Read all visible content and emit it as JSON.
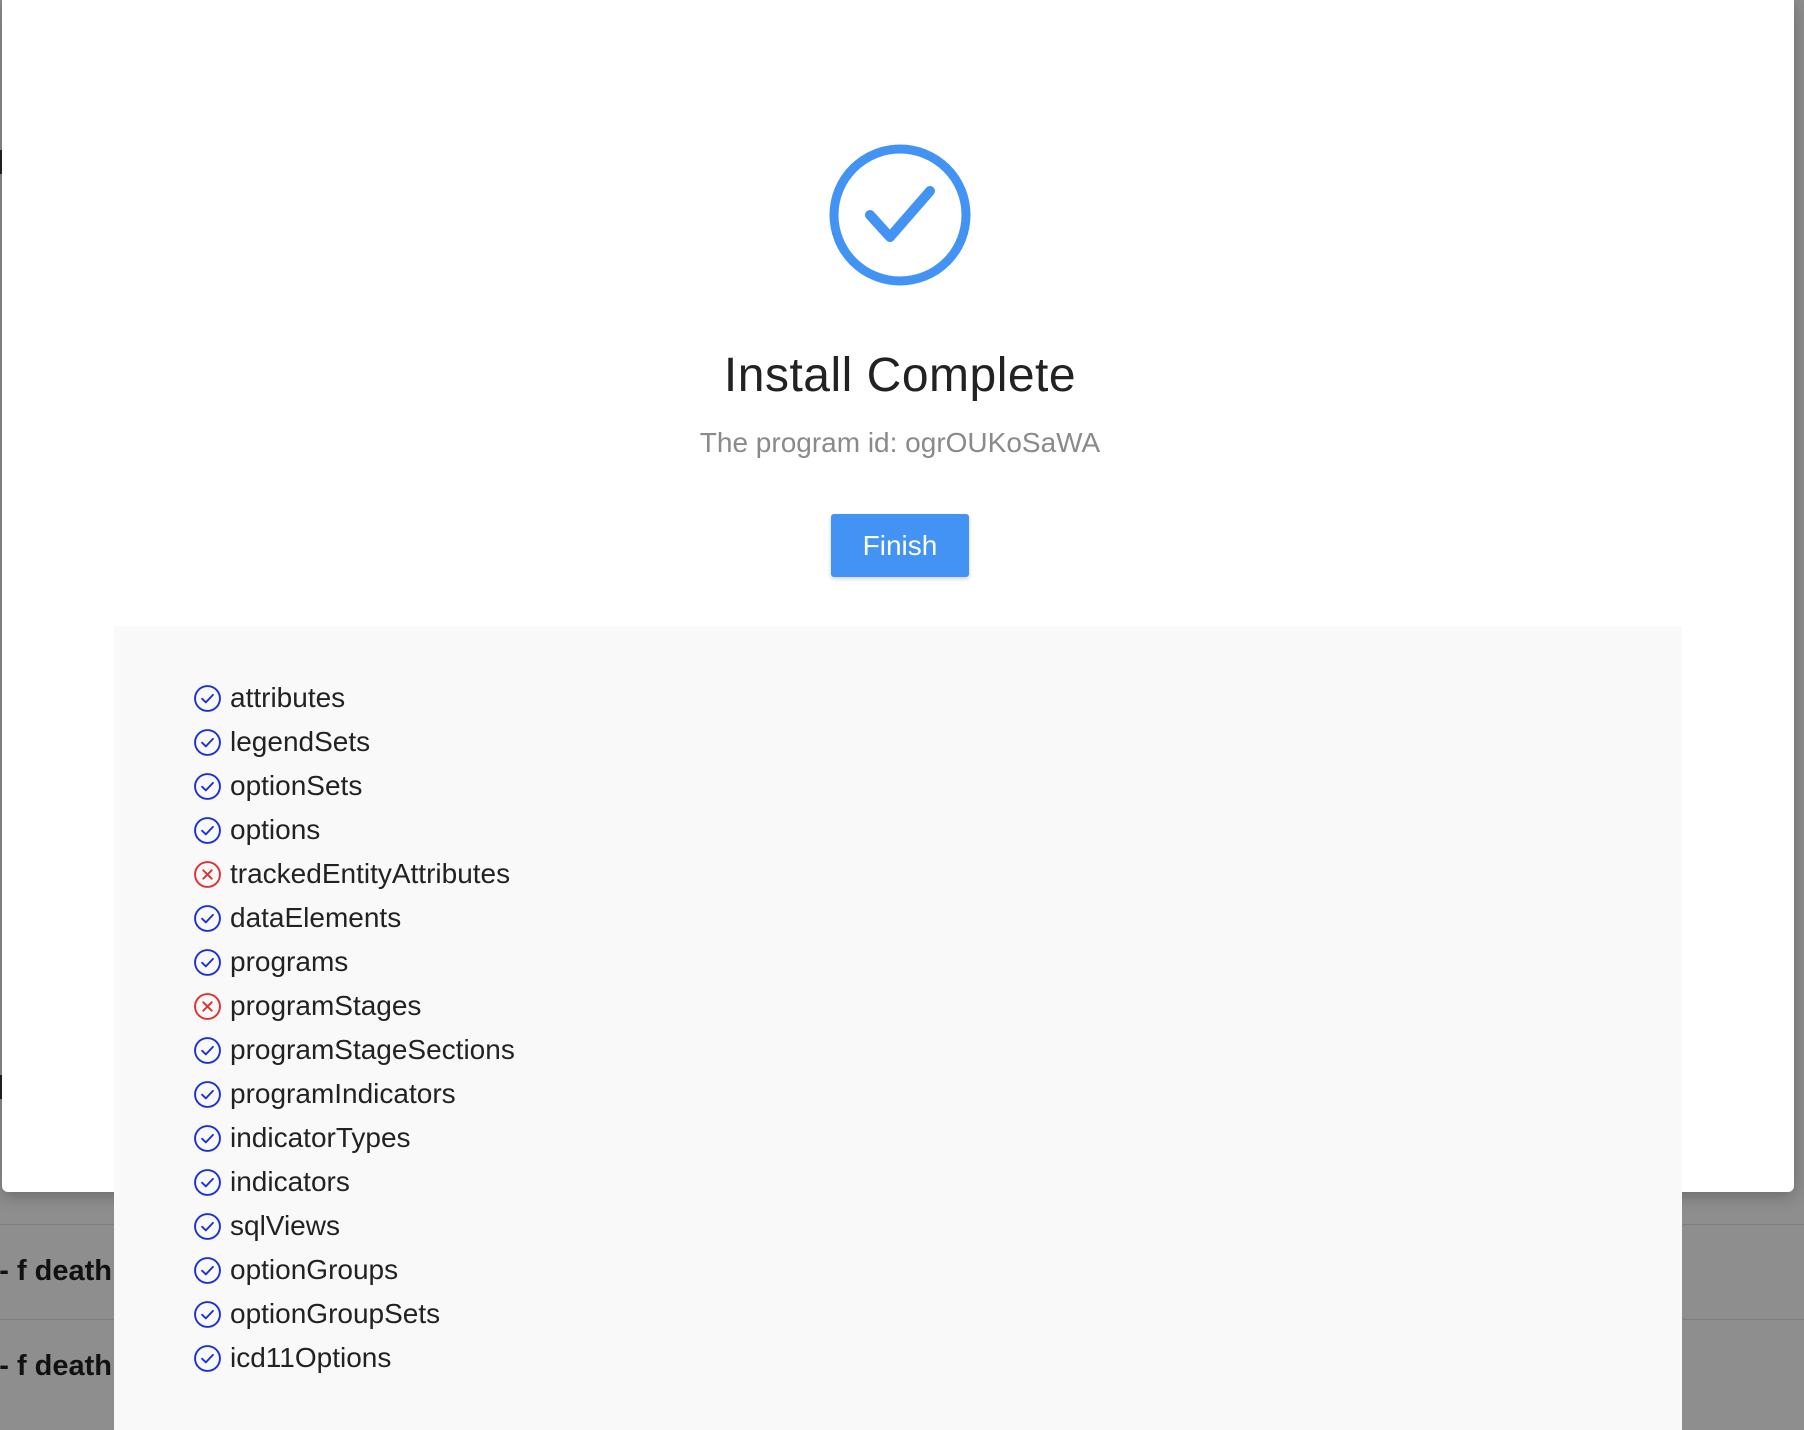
{
  "background": {
    "rows": [
      {
        "label": "f death -"
      },
      {
        "label": "f death -"
      }
    ]
  },
  "modal": {
    "title": "Install Complete",
    "subtitle": "The program id: ogrOUKoSaWA",
    "finish_label": "Finish",
    "colors": {
      "accent": "#4293f3",
      "success_icon": "#1a33d6",
      "error_icon": "#e03131"
    }
  },
  "results": [
    {
      "label": "attributes",
      "status": "success",
      "icon": "check-circle-icon"
    },
    {
      "label": "legendSets",
      "status": "success",
      "icon": "check-circle-icon"
    },
    {
      "label": "optionSets",
      "status": "success",
      "icon": "check-circle-icon"
    },
    {
      "label": "options",
      "status": "success",
      "icon": "check-circle-icon"
    },
    {
      "label": "trackedEntityAttributes",
      "status": "error",
      "icon": "x-circle-icon"
    },
    {
      "label": "dataElements",
      "status": "success",
      "icon": "check-circle-icon"
    },
    {
      "label": "programs",
      "status": "success",
      "icon": "check-circle-icon"
    },
    {
      "label": "programStages",
      "status": "error",
      "icon": "x-circle-icon"
    },
    {
      "label": "programStageSections",
      "status": "success",
      "icon": "check-circle-icon"
    },
    {
      "label": "programIndicators",
      "status": "success",
      "icon": "check-circle-icon"
    },
    {
      "label": "indicatorTypes",
      "status": "success",
      "icon": "check-circle-icon"
    },
    {
      "label": "indicators",
      "status": "success",
      "icon": "check-circle-icon"
    },
    {
      "label": "sqlViews",
      "status": "success",
      "icon": "check-circle-icon"
    },
    {
      "label": "optionGroups",
      "status": "success",
      "icon": "check-circle-icon"
    },
    {
      "label": "optionGroupSets",
      "status": "success",
      "icon": "check-circle-icon"
    },
    {
      "label": "icd11Options",
      "status": "success",
      "icon": "check-circle-icon"
    }
  ]
}
